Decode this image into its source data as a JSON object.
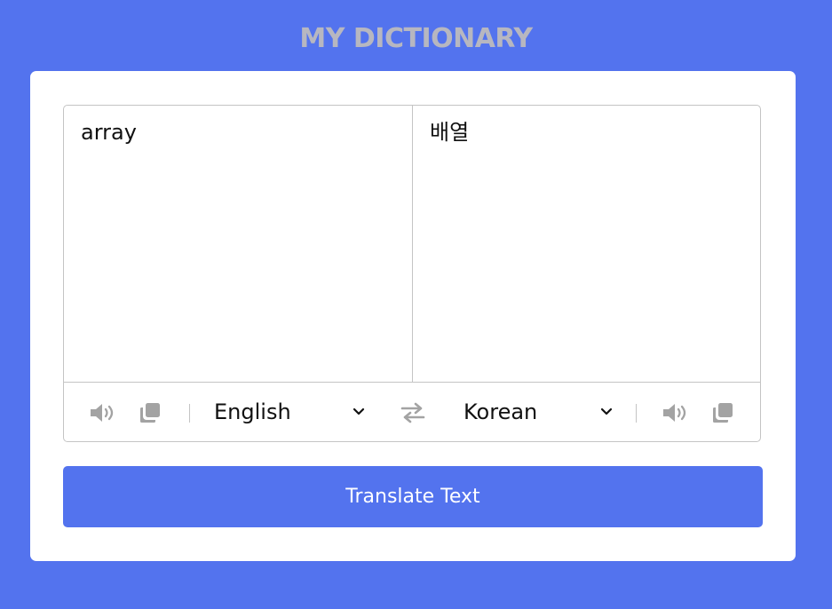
{
  "app": {
    "title": "MY DICTIONARY"
  },
  "translator": {
    "from_text": "array",
    "to_text": "배열",
    "from_language": "English",
    "to_language": "Korean"
  },
  "actions": {
    "translate_label": "Translate Text"
  },
  "icons": {
    "speaker": "speaker-icon",
    "copy": "copy-icon",
    "swap": "swap-arrows-icon",
    "chevron": "chevron-down-icon"
  },
  "colors": {
    "background": "#5373ee",
    "button": "#5373ee",
    "title": "#b7b7c0",
    "icon": "#a3a3a3",
    "border": "#c4c4c4"
  }
}
